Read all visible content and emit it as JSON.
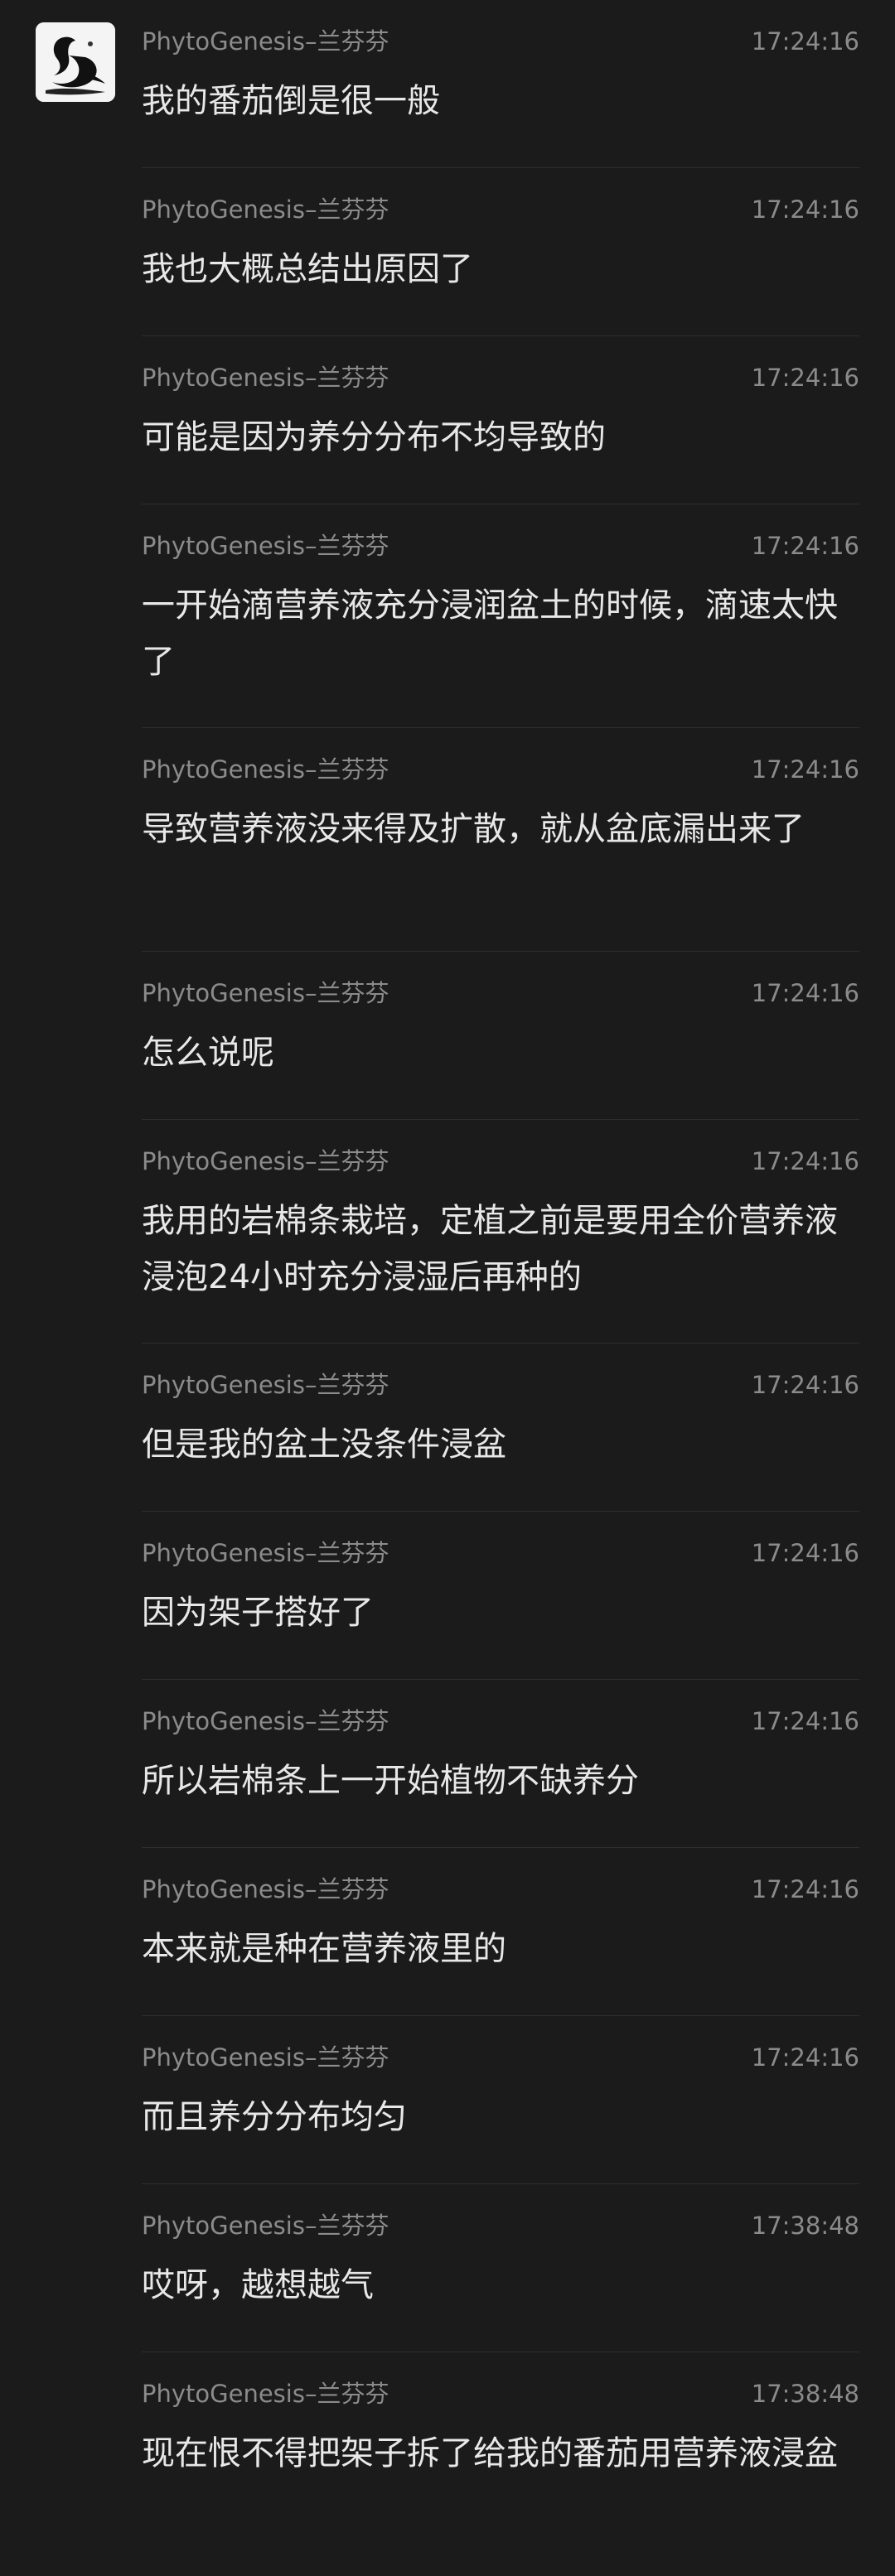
{
  "sender": {
    "avatar_icon": "swan-ink-art-avatar"
  },
  "messages": [
    {
      "sender": "PhytoGenesis–兰芬芬",
      "time": "17:24:16",
      "text": "我的番茄倒是很一般"
    },
    {
      "sender": "PhytoGenesis–兰芬芬",
      "time": "17:24:16",
      "text": "我也大概总结出原因了"
    },
    {
      "sender": "PhytoGenesis–兰芬芬",
      "time": "17:24:16",
      "text": "可能是因为养分分布不均导致的"
    },
    {
      "sender": "PhytoGenesis–兰芬芬",
      "time": "17:24:16",
      "text": "一开始滴营养液充分浸润盆土的时候，滴速太快了"
    },
    {
      "sender": "PhytoGenesis–兰芬芬",
      "time": "17:24:16",
      "text": "导致营养液没来得及扩散，就从盆底漏出来了"
    },
    {
      "sender": "PhytoGenesis–兰芬芬",
      "time": "17:24:16",
      "text": "怎么说呢"
    },
    {
      "sender": "PhytoGenesis–兰芬芬",
      "time": "17:24:16",
      "text": "我用的岩棉条栽培，定植之前是要用全价营养液浸泡24小时充分浸湿后再种的"
    },
    {
      "sender": "PhytoGenesis–兰芬芬",
      "time": "17:24:16",
      "text": "但是我的盆土没条件浸盆"
    },
    {
      "sender": "PhytoGenesis–兰芬芬",
      "time": "17:24:16",
      "text": "因为架子搭好了"
    },
    {
      "sender": "PhytoGenesis–兰芬芬",
      "time": "17:24:16",
      "text": "所以岩棉条上一开始植物不缺养分"
    },
    {
      "sender": "PhytoGenesis–兰芬芬",
      "time": "17:24:16",
      "text": "本来就是种在营养液里的"
    },
    {
      "sender": "PhytoGenesis–兰芬芬",
      "time": "17:24:16",
      "text": "而且养分分布均匀"
    },
    {
      "sender": "PhytoGenesis–兰芬芬",
      "time": "17:38:48",
      "text": "哎呀，越想越气"
    },
    {
      "sender": "PhytoGenesis–兰芬芬",
      "time": "17:38:48",
      "text": "现在恨不得把架子拆了给我的番茄用营养液浸盆"
    }
  ]
}
